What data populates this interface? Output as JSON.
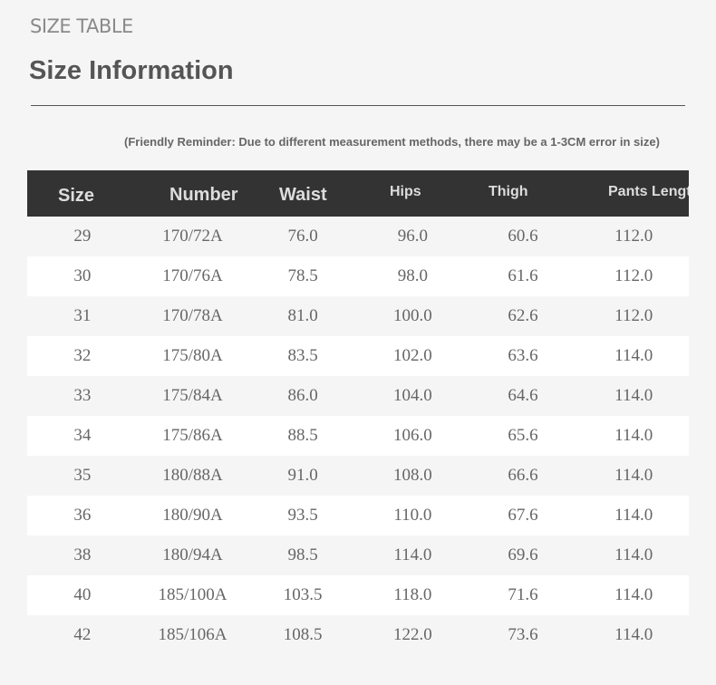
{
  "header": {
    "eyebrow": "SIZE TABLE",
    "title": "Size Information",
    "reminder": "(Friendly Reminder: Due to different measurement methods, there may be a 1-3CM error in size)"
  },
  "table": {
    "columns": [
      "Size",
      "Number",
      "Waist",
      "Hips",
      "Thigh",
      "Pants Length"
    ],
    "rows": [
      [
        "29",
        "170/72A",
        "76.0",
        "96.0",
        "60.6",
        "112.0"
      ],
      [
        "30",
        "170/76A",
        "78.5",
        "98.0",
        "61.6",
        "112.0"
      ],
      [
        "31",
        "170/78A",
        "81.0",
        "100.0",
        "62.6",
        "112.0"
      ],
      [
        "32",
        "175/80A",
        "83.5",
        "102.0",
        "63.6",
        "114.0"
      ],
      [
        "33",
        "175/84A",
        "86.0",
        "104.0",
        "64.6",
        "114.0"
      ],
      [
        "34",
        "175/86A",
        "88.5",
        "106.0",
        "65.6",
        "114.0"
      ],
      [
        "35",
        "180/88A",
        "91.0",
        "108.0",
        "66.6",
        "114.0"
      ],
      [
        "36",
        "180/90A",
        "93.5",
        "110.0",
        "67.6",
        "114.0"
      ],
      [
        "38",
        "180/94A",
        "98.5",
        "114.0",
        "69.6",
        "114.0"
      ],
      [
        "40",
        "185/100A",
        "103.5",
        "118.0",
        "71.6",
        "114.0"
      ],
      [
        "42",
        "185/106A",
        "108.5",
        "122.0",
        "73.6",
        "114.0"
      ]
    ]
  },
  "colors": {
    "background": "#f5f5f5",
    "header_bg": "#333333",
    "header_text": "#dddddd",
    "row_alt": "#ffffff",
    "text": "#666666"
  }
}
